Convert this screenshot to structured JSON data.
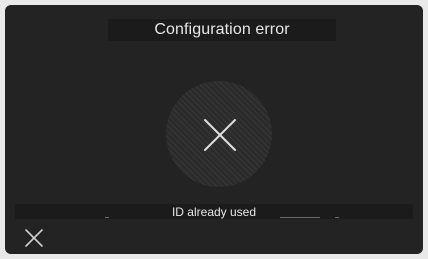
{
  "dialog": {
    "title": "Configuration error",
    "status_icon": "error-x-icon",
    "message": "ID already used"
  },
  "footer": {
    "close_icon": "close-icon"
  },
  "colors": {
    "background": "#232323",
    "text": "#e6e6e6",
    "icon": "#e0e0e0"
  }
}
